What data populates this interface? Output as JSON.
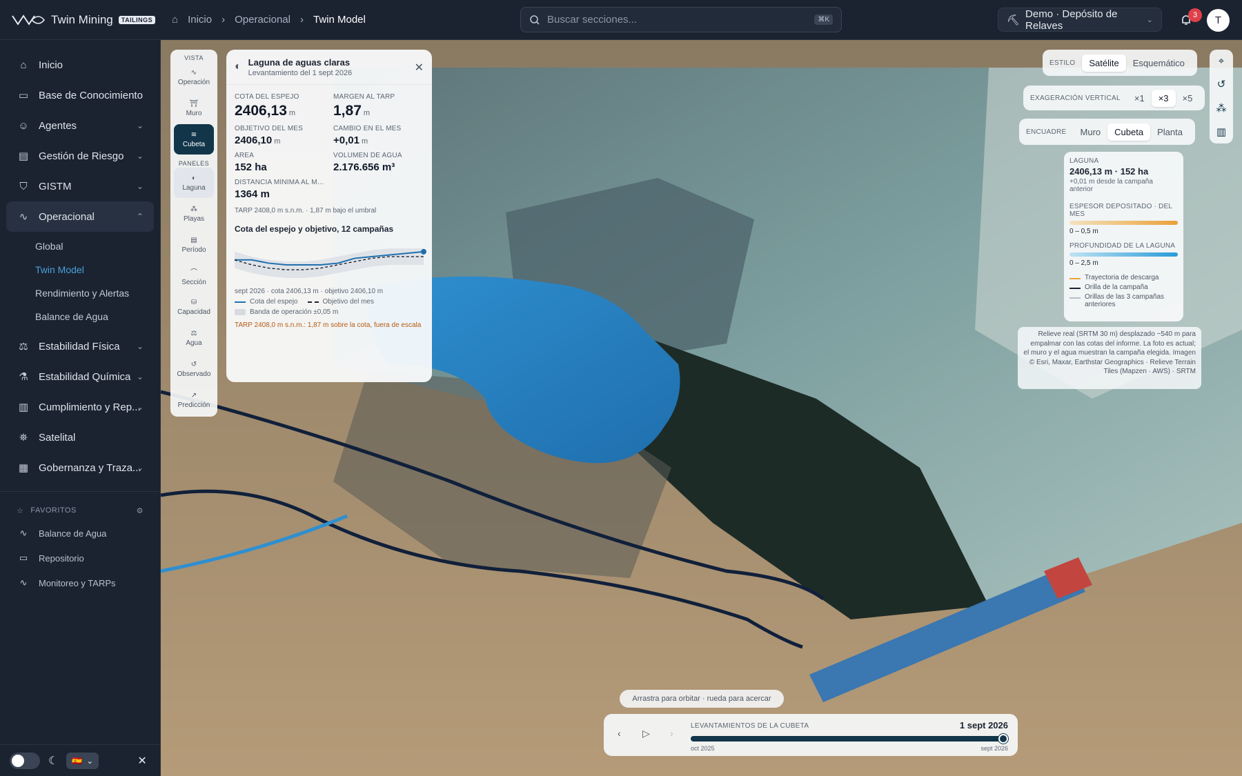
{
  "brand": {
    "name": "Twin Mining",
    "badge": "TAILINGS"
  },
  "breadcrumb": [
    "Inicio",
    "Operacional",
    "Twin Model"
  ],
  "search": {
    "placeholder": "Buscar secciones...",
    "shortcut": "⌘K"
  },
  "project": {
    "label": "Demo · Depósito de Relaves"
  },
  "notifications": {
    "count": "3"
  },
  "user": {
    "initial": "T"
  },
  "sidebar": {
    "items": [
      {
        "label": "Inicio",
        "icon": "home-icon"
      },
      {
        "label": "Base de Conocimiento",
        "icon": "book-icon"
      },
      {
        "label": "Agentes",
        "icon": "bot-icon"
      },
      {
        "label": "Gestión de Riesgo",
        "icon": "clipboard-icon"
      },
      {
        "label": "GISTM",
        "icon": "shield-icon"
      },
      {
        "label": "Operacional",
        "icon": "activity-icon"
      },
      {
        "label": "Estabilidad Física",
        "icon": "scale-icon"
      },
      {
        "label": "Estabilidad Química",
        "icon": "flask-icon"
      },
      {
        "label": "Cumplimiento y Rep...",
        "icon": "bar-chart-icon"
      },
      {
        "label": "Satelital",
        "icon": "satellite-icon"
      },
      {
        "label": "Gobernanza y Traza...",
        "icon": "ledger-icon"
      }
    ],
    "sub_items": [
      "Global",
      "Twin Model",
      "Rendimiento y Alertas",
      "Balance de Agua"
    ],
    "favorites_title": "FAVORITOS",
    "favorites": [
      "Balance de Agua",
      "Repositorio",
      "Monitoreo y TARPs"
    ],
    "language": "🇪🇸"
  },
  "rail": {
    "vista_title": "VISTA",
    "vista": [
      "Operación",
      "Muro",
      "Cubeta"
    ],
    "paneles_title": "PANELES",
    "paneles": [
      "Laguna",
      "Playas",
      "Período",
      "Sección",
      "Capacidad",
      "Agua",
      "Observado",
      "Predicción"
    ]
  },
  "panel": {
    "title": "Laguna de aguas claras",
    "subtitle": "Levantamiento del 1 sept 2026",
    "metrics": [
      {
        "label": "COTA DEL ESPEJO",
        "value": "2406,13",
        "unit": "m"
      },
      {
        "label": "MARGEN AL TARP",
        "value": "1,87",
        "unit": "m"
      },
      {
        "label": "OBJETIVO DEL MES",
        "value": "2406,10",
        "unit": "m"
      },
      {
        "label": "CAMBIO EN EL MES",
        "value": "+0,01",
        "unit": "m"
      },
      {
        "label": "ÁREA",
        "value": "152 ha",
        "unit": ""
      },
      {
        "label": "VOLUMEN DE AGUA",
        "value": "2.176.656 m³",
        "unit": ""
      },
      {
        "label": "DISTANCIA MÍNIMA AL MURO",
        "value": "1364 m",
        "unit": ""
      }
    ],
    "tarp_note": "TARP 2408,0 m s.n.m. · 1,87 m bajo el umbral",
    "chart_title": "Cota del espejo y objetivo, 12 campañas",
    "chart_caption": "sept 2026 · cota 2406,13 m · objetivo 2406,10 m",
    "legend": [
      "Cota del espejo",
      "Objetivo del mes",
      "Banda de operación ±0,05 m"
    ],
    "warning": "TARP 2408,0 m s.n.m.: 1,87 m sobre la cota, fuera de escala"
  },
  "chart_data": {
    "type": "line",
    "x": [
      1,
      2,
      3,
      4,
      5,
      6,
      7,
      8,
      9,
      10,
      11,
      12
    ],
    "series": [
      {
        "name": "Cota del espejo",
        "values": [
          2406.08,
          2406.08,
          2406.06,
          2406.05,
          2406.05,
          2406.05,
          2406.06,
          2406.09,
          2406.1,
          2406.11,
          2406.12,
          2406.13
        ]
      },
      {
        "name": "Objetivo del mes",
        "values": [
          2406.08,
          2406.05,
          2406.03,
          2406.02,
          2406.02,
          2406.03,
          2406.05,
          2406.07,
          2406.09,
          2406.1,
          2406.1,
          2406.1
        ]
      }
    ],
    "band": 0.05,
    "ylim": [
      1,
      0
    ]
  },
  "controls": {
    "style_label": "ESTILO",
    "style_options": [
      "Satélite",
      "Esquemático"
    ],
    "style_selected": 0,
    "exag_label": "EXAGERACIÓN VERTICAL",
    "exag_options": [
      "×1",
      "×3",
      "×5"
    ],
    "exag_selected": 1,
    "frame_label": "ENCUADRE",
    "frame_options": [
      "Muro",
      "Cubeta",
      "Planta"
    ],
    "frame_selected": 1
  },
  "map_legend": {
    "title": "LAGUNA",
    "value": "2406,13 m · 152 ha",
    "delta": "+0,01 m desde la campaña anterior",
    "espesor_title": "ESPESOR DEPOSITADO · DEL MES",
    "espesor_range": "0 – 0,5 m",
    "prof_title": "PROFUNDIDAD DE LA LAGUNA",
    "prof_range": "0 – 2,5 m",
    "lines": [
      "Trayectoria de descarga",
      "Orilla de la campaña",
      "Orillas de las 3 campañas anteriores"
    ],
    "colors": {
      "discharge": "#e8a13a",
      "shore": "#1b2331",
      "prev": "#b8bec8"
    }
  },
  "attribution": "Relieve real (SRTM 30 m) desplazado −540 m para empalmar con las cotas del informe. La foto es actual; el muro y el agua muestran la campaña elegida. Imagen © Esri, Maxar, Earthstar Geographics · Relieve Terrain Tiles (Mapzen · AWS) · SRTM",
  "hint": "Arrastra para orbitar · rueda para acercar",
  "timeline": {
    "label": "LEVANTAMIENTOS DE LA CUBETA",
    "current": "1 sept 2026",
    "start": "oct 2025",
    "end": "sept 2026",
    "progress": 1.0
  }
}
